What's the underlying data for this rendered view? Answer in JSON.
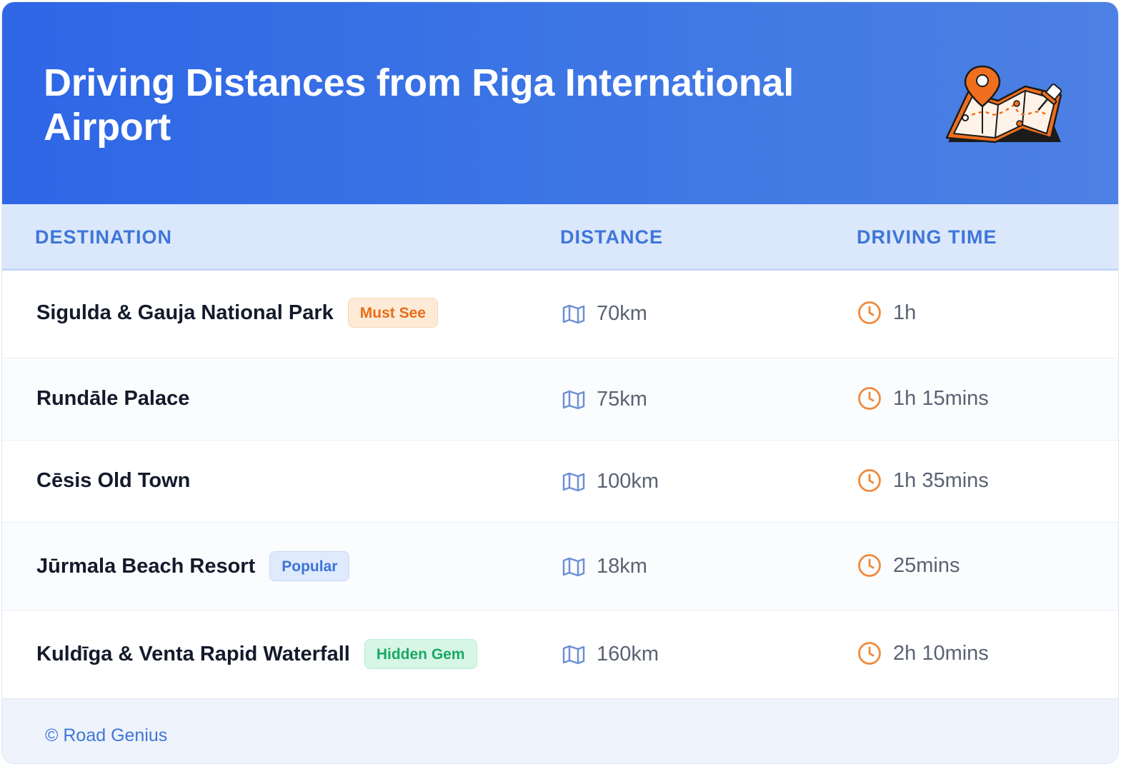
{
  "header": {
    "title": "Driving Distances from Riga International Airport",
    "illustration_icon": "map-with-pin-icon"
  },
  "table": {
    "columns": [
      "DESTINATION",
      "DISTANCE",
      "DRIVING TIME"
    ],
    "rows": [
      {
        "destination": "Sigulda & Gauja National Park",
        "badge": "Must See",
        "badge_color": "#ea6c16",
        "distance": "70km",
        "time": "1h"
      },
      {
        "destination": "Rundāle Palace",
        "badge": "",
        "badge_color": "",
        "distance": "75km",
        "time": "1h 15mins"
      },
      {
        "destination": "Cēsis Old Town",
        "badge": "",
        "badge_color": "",
        "distance": "100km",
        "time": "1h 35mins"
      },
      {
        "destination": "Jūrmala Beach Resort",
        "badge": "Popular",
        "badge_color": "#3c74d6",
        "distance": "18km",
        "time": "25mins"
      },
      {
        "destination": "Kuldīga & Venta Rapid Waterfall",
        "badge": "Hidden Gem",
        "badge_color": "#1aa864",
        "distance": "160km",
        "time": "2h 10mins"
      }
    ],
    "distance_icon": "map-icon",
    "time_icon": "clock-icon"
  },
  "footer": {
    "copyright": "© Road Genius"
  },
  "colors": {
    "header_gradient_start": "#2e66e6",
    "header_gradient_end": "#4d80e3",
    "accent_blue": "#3f76d8",
    "accent_orange": "#f08a3c"
  }
}
